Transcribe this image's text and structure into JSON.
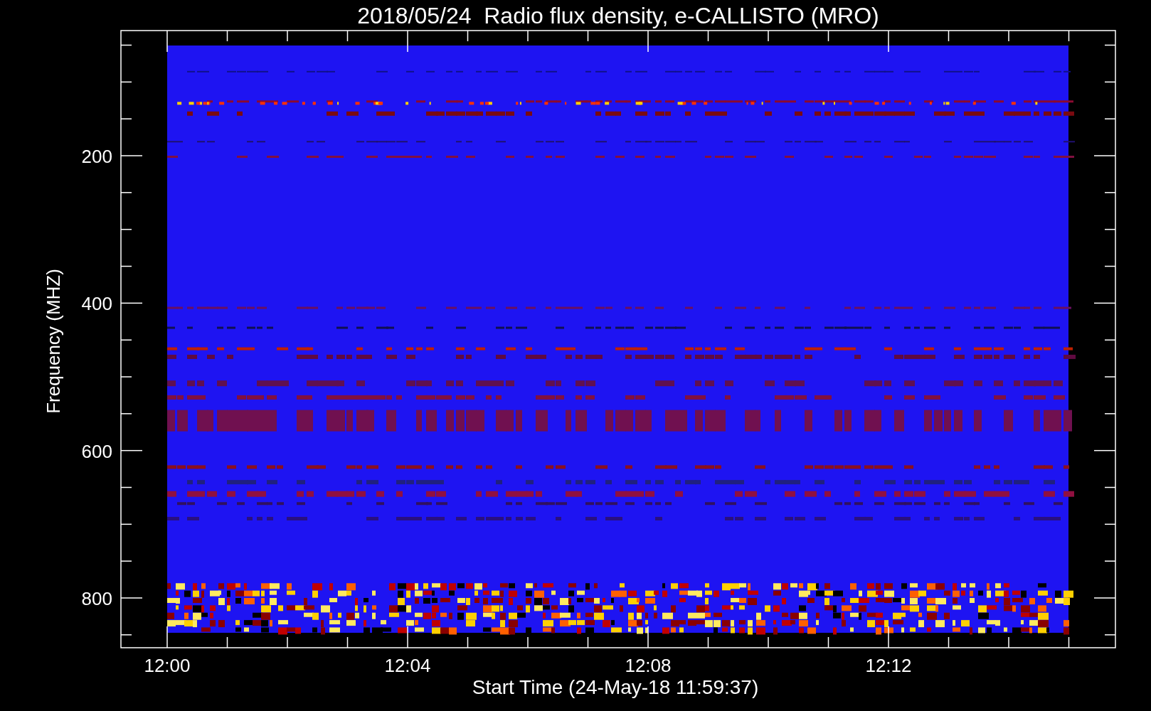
{
  "title": "2018/05/24  Radio flux density, e-CALLISTO (MRO)",
  "y_axis": {
    "label": "Frequency (MHZ)",
    "ticks": [
      "200",
      "400",
      "600",
      "800"
    ]
  },
  "x_axis": {
    "label": "Start Time (24-May-18 11:59:37)",
    "ticks": [
      "12:00",
      "12:04",
      "12:08",
      "12:12"
    ]
  }
}
